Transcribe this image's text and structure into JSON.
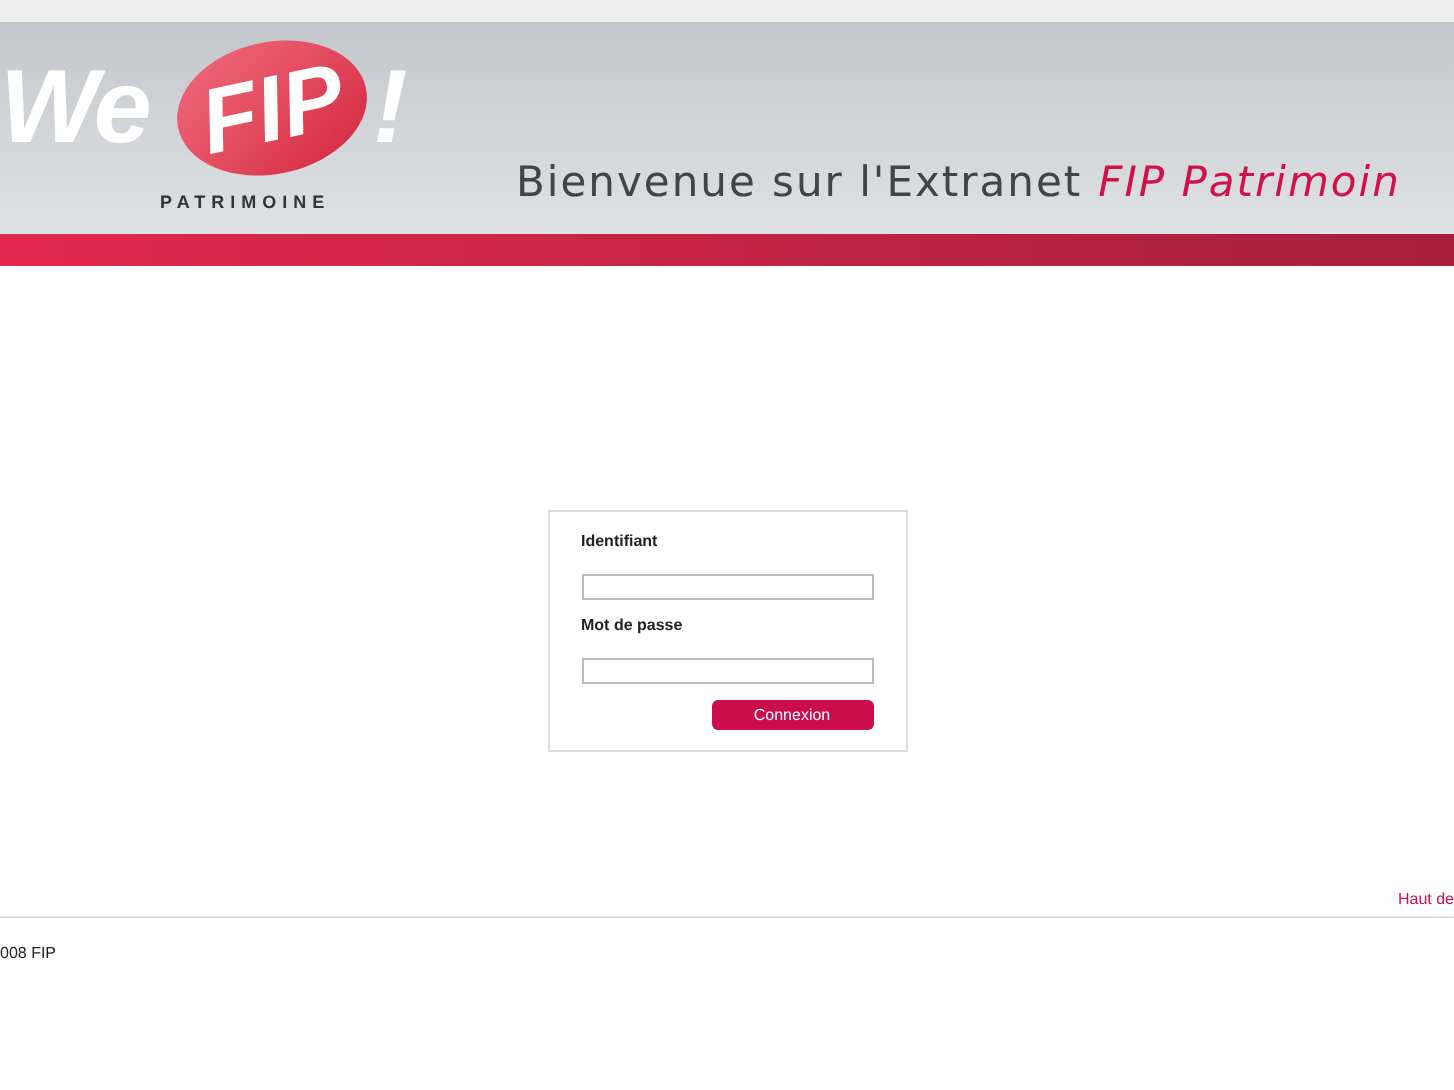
{
  "header": {
    "logo": {
      "word": "We",
      "badge": "FIP",
      "exclaim": "!",
      "subtitle": "PATRIMOINE"
    },
    "welcome": "Bienvenue sur l'Extranet",
    "brand": "FIP Patrimoin"
  },
  "login": {
    "fields": [
      {
        "label": "Identifiant"
      },
      {
        "label": "Mot de passe"
      }
    ],
    "submit": "Connexion"
  },
  "footer": {
    "top_link": "Haut de",
    "copyright": "008 FIP"
  }
}
